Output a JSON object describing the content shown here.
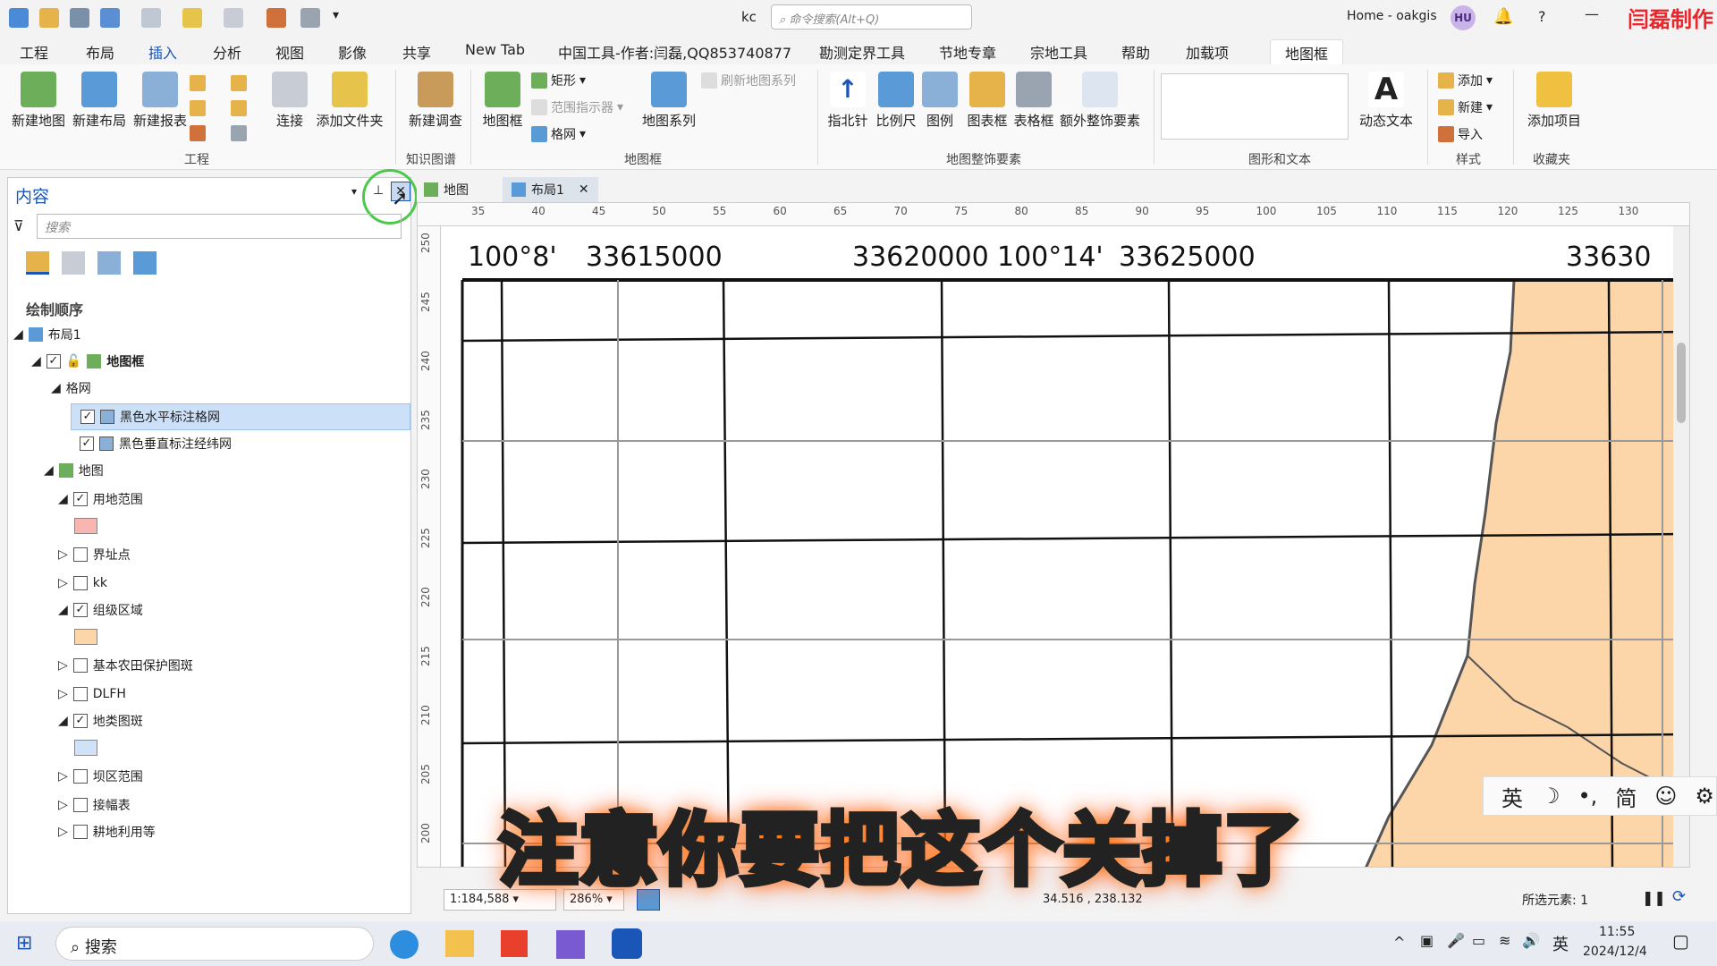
{
  "titlebar": {
    "title": "kc",
    "search_placeholder": "命令搜索(Alt+Q)",
    "account": "Home - oakgis",
    "avatar": "HU",
    "help": "?",
    "minimize": "—",
    "watermark": "闫磊制作"
  },
  "tabs": [
    "工程",
    "布局",
    "插入",
    "分析",
    "视图",
    "影像",
    "共享",
    "New Tab",
    "中国工具-作者:闫磊,QQ853740877",
    "勘测定界工具",
    "节地专章",
    "宗地工具",
    "帮助",
    "加载项",
    "地图框"
  ],
  "ribbon": {
    "project": {
      "buttons": [
        "新建地图",
        "新建布局",
        "新建报表",
        "连接",
        "添加文件夹"
      ],
      "label": "工程"
    },
    "kg": {
      "buttons": [
        "新建调查"
      ],
      "label": "知识图谱"
    },
    "frame": {
      "mapframe": "地图框",
      "rect": "矩形",
      "extent": "范围指示器",
      "grid": "格网",
      "series": "地图系列",
      "refresh": "刷新地图系列",
      "label": "地图框"
    },
    "surround": {
      "buttons": [
        "指北针",
        "比例尺",
        "图例",
        "图表框",
        "表格框",
        "额外整饰要素"
      ],
      "label": "地图整饰要素"
    },
    "graphics": {
      "dyntext": "动态文本",
      "label": "图形和文本"
    },
    "style": {
      "add": "添加",
      "new": "新建",
      "import": "导入",
      "label": "样式"
    },
    "fav": {
      "additem": "添加项目",
      "label": "收藏夹"
    }
  },
  "contents": {
    "title": "内容",
    "search_placeholder": "搜索",
    "draw_order": "绘制顺序",
    "tree": [
      "布局1",
      "地图框",
      "格网",
      "黑色水平标注格网",
      "黑色垂直标注经纬网",
      "地图",
      "用地范围",
      "界址点",
      "kk",
      "组级区域",
      "基本农田保护图斑",
      "DLFH",
      "地类图斑",
      "坝区范围",
      "接幅表",
      "耕地利用等"
    ]
  },
  "maptabs": {
    "map": "地图",
    "layout": "布局1"
  },
  "ruler_h": [
    "35",
    "40",
    "45",
    "50",
    "55",
    "60",
    "65",
    "70",
    "75",
    "80",
    "85",
    "90",
    "95",
    "100",
    "105",
    "110",
    "115",
    "120",
    "125",
    "130"
  ],
  "ruler_v": [
    "250",
    "245",
    "240",
    "235",
    "230",
    "225",
    "220",
    "215",
    "210",
    "205",
    "200"
  ],
  "map_labels": {
    "l1": "100°8'",
    "l2": "33615000",
    "l3": "33620000",
    "l4": "100°14'",
    "l5": "33625000",
    "l6": "33630"
  },
  "status": {
    "scale": "1:184,588",
    "zoom": "286%",
    "coords": "34.516 , 238.132",
    "selected": "所选元素: 1"
  },
  "subtitle": "注意你要把这个关掉了",
  "ime": [
    "英",
    "简"
  ],
  "taskbar": {
    "search": "搜索",
    "time": "11:55",
    "date": "2024/12/4",
    "lang": "英"
  },
  "colors": {
    "accent": "#1a56b8",
    "orange_fill": "#fcd5a8",
    "pink_fill": "#f7b7b0",
    "blue_fill": "#cfe2f7",
    "highlight_ring": "#4cc94c"
  }
}
